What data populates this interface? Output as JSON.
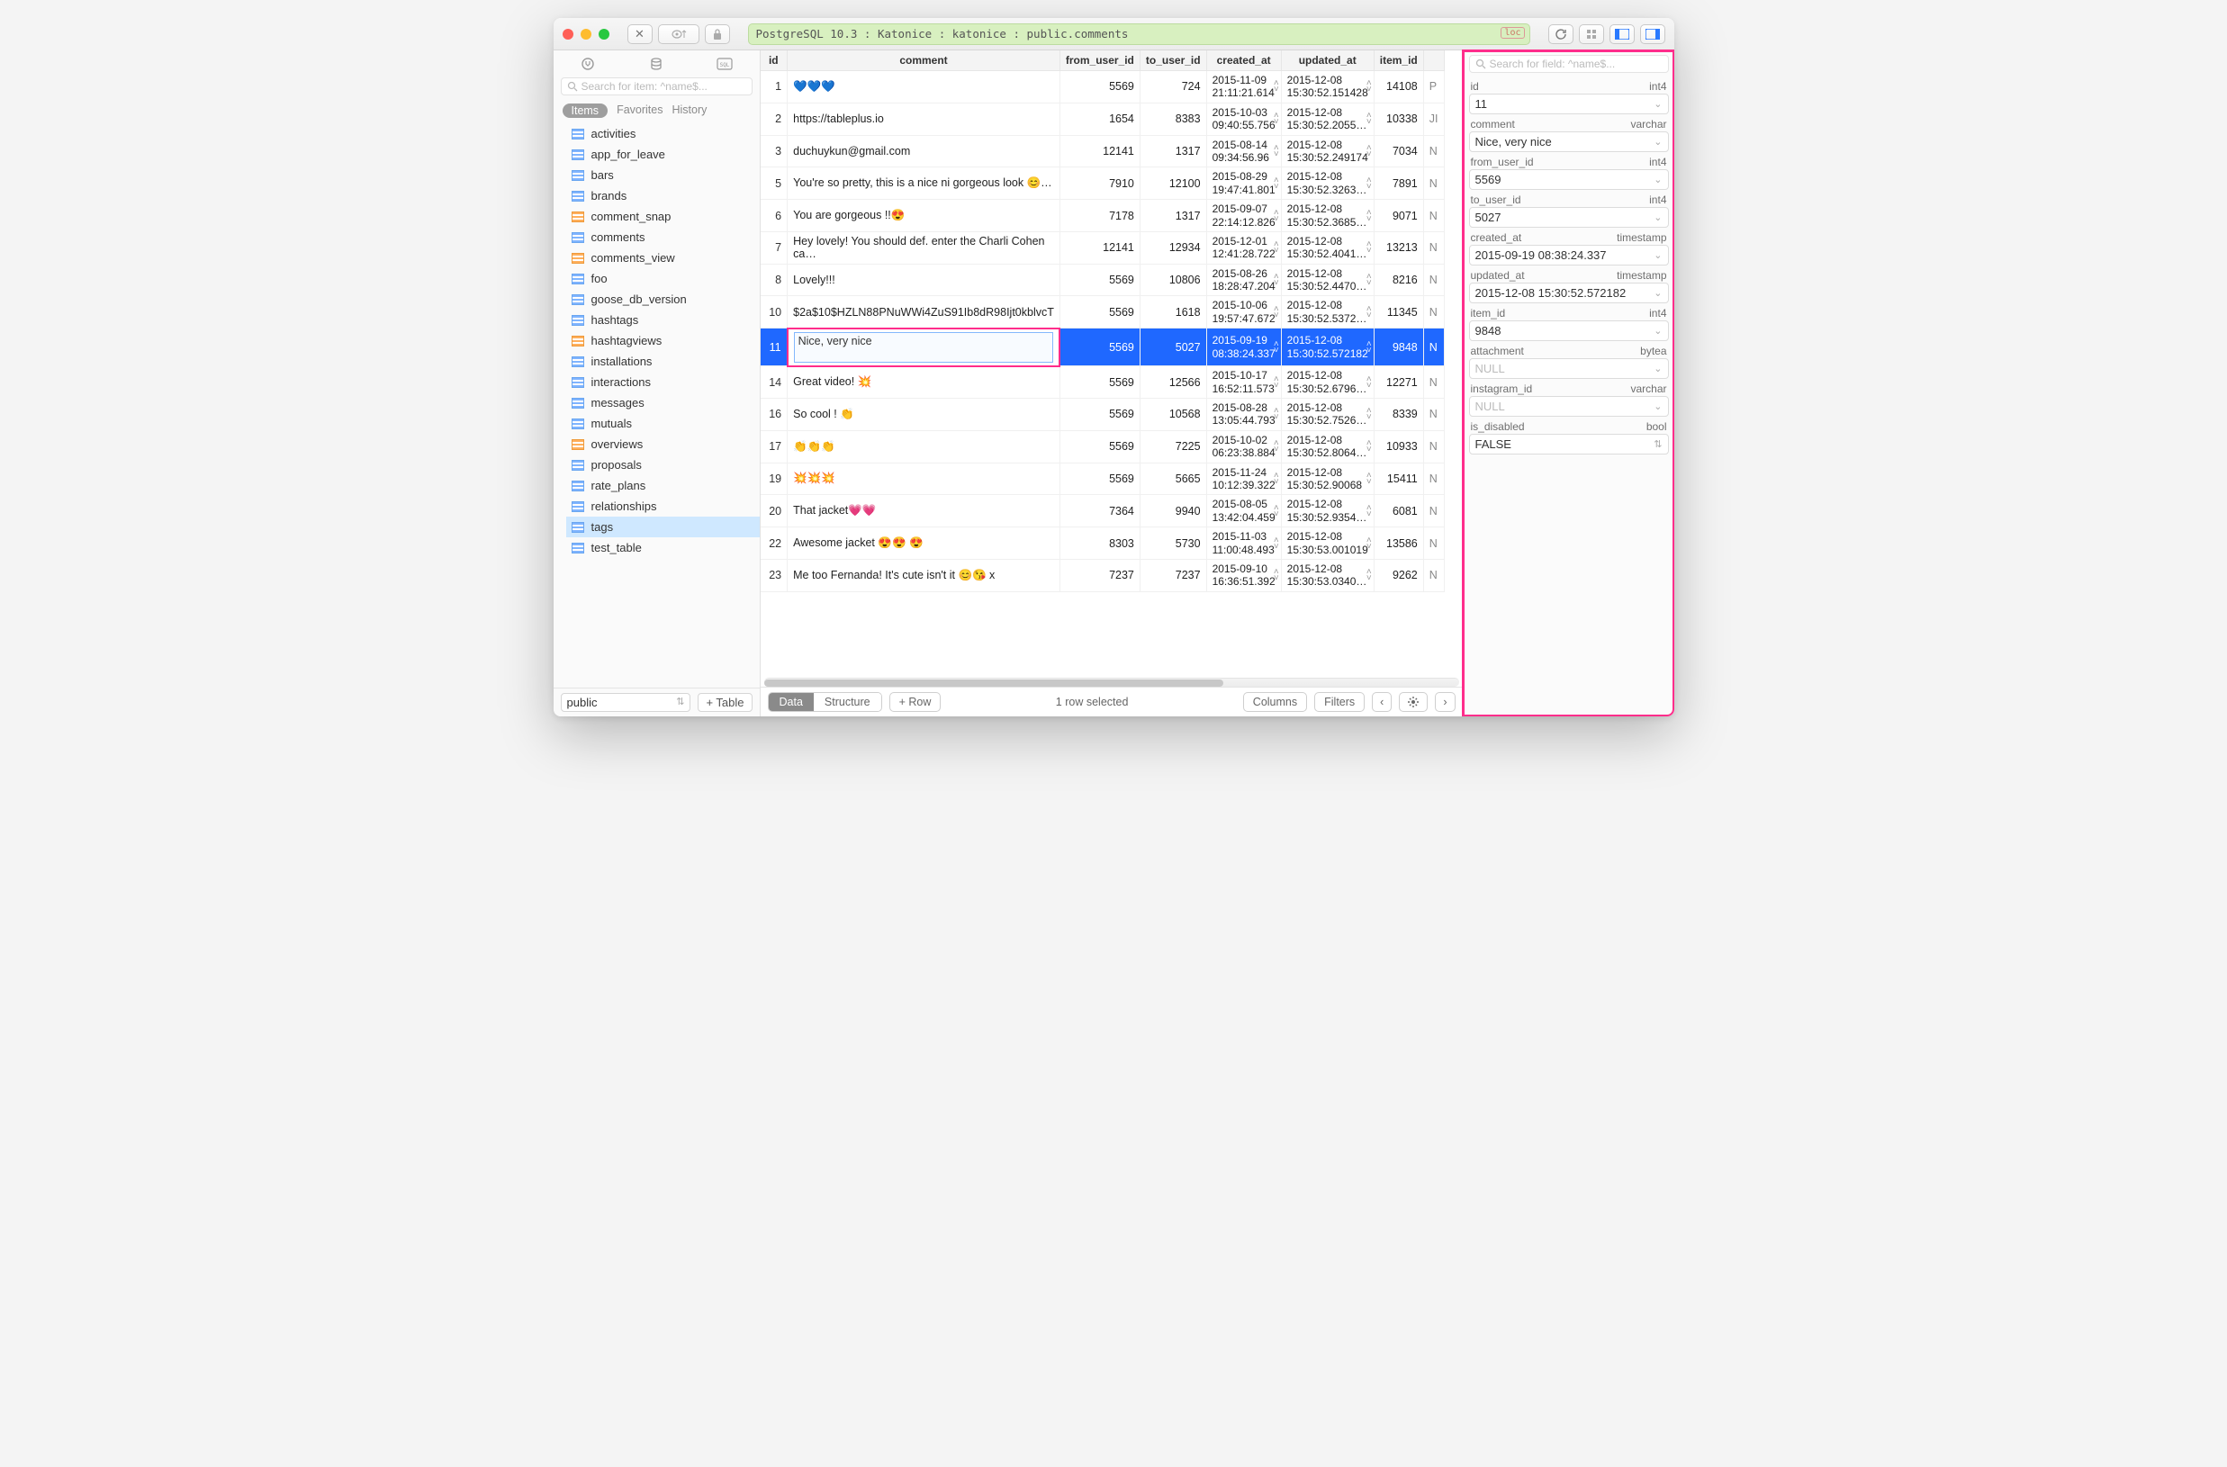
{
  "titlebar": {
    "breadcrumb": "PostgreSQL 10.3 : Katonice : katonice : public.comments",
    "loc_badge": "loc"
  },
  "sidebar": {
    "search_placeholder": "Search for item: ^name$...",
    "tabs": {
      "items": "Items",
      "favorites": "Favorites",
      "history": "History"
    },
    "tables": [
      {
        "name": "activities",
        "kind": "table"
      },
      {
        "name": "app_for_leave",
        "kind": "table"
      },
      {
        "name": "bars",
        "kind": "table"
      },
      {
        "name": "brands",
        "kind": "table"
      },
      {
        "name": "comment_snap",
        "kind": "view"
      },
      {
        "name": "comments",
        "kind": "table"
      },
      {
        "name": "comments_view",
        "kind": "view"
      },
      {
        "name": "foo",
        "kind": "table"
      },
      {
        "name": "goose_db_version",
        "kind": "table"
      },
      {
        "name": "hashtags",
        "kind": "table"
      },
      {
        "name": "hashtagviews",
        "kind": "view"
      },
      {
        "name": "installations",
        "kind": "table"
      },
      {
        "name": "interactions",
        "kind": "table"
      },
      {
        "name": "messages",
        "kind": "table"
      },
      {
        "name": "mutuals",
        "kind": "table"
      },
      {
        "name": "overviews",
        "kind": "view"
      },
      {
        "name": "proposals",
        "kind": "table"
      },
      {
        "name": "rate_plans",
        "kind": "table"
      },
      {
        "name": "relationships",
        "kind": "table"
      },
      {
        "name": "tags",
        "kind": "table",
        "selected": true
      },
      {
        "name": "test_table",
        "kind": "table"
      }
    ],
    "schema_selector": "public",
    "add_table_btn": "+  Table"
  },
  "table": {
    "columns": [
      "id",
      "comment",
      "from_user_id",
      "to_user_id",
      "created_at",
      "updated_at",
      "item_id",
      ""
    ],
    "rows": [
      {
        "id": "1",
        "comment": "💙💙💙",
        "from": "5569",
        "to": "724",
        "created": "2015-11-09 21:11:21.614",
        "updated": "2015-12-08 15:30:52.151428",
        "item": "14108",
        "trail": "P"
      },
      {
        "id": "2",
        "comment": "https://tableplus.io",
        "from": "1654",
        "to": "8383",
        "created": "2015-10-03 09:40:55.756",
        "updated": "2015-12-08 15:30:52.2055…",
        "item": "10338",
        "trail": "JI"
      },
      {
        "id": "3",
        "comment": "duchuykun@gmail.com",
        "from": "12141",
        "to": "1317",
        "created": "2015-08-14 09:34:56.96",
        "updated": "2015-12-08 15:30:52.249174",
        "item": "7034",
        "trail": "N"
      },
      {
        "id": "5",
        "comment": "You're so pretty, this is a nice ni gorgeous look 😊…",
        "from": "7910",
        "to": "12100",
        "created": "2015-08-29 19:47:41.801",
        "updated": "2015-12-08 15:30:52.3263…",
        "item": "7891",
        "trail": "N"
      },
      {
        "id": "6",
        "comment": "You are gorgeous !!😍",
        "from": "7178",
        "to": "1317",
        "created": "2015-09-07 22:14:12.826",
        "updated": "2015-12-08 15:30:52.3685…",
        "item": "9071",
        "trail": "N"
      },
      {
        "id": "7",
        "comment": "Hey lovely! You should def. enter the Charli Cohen ca…",
        "from": "12141",
        "to": "12934",
        "created": "2015-12-01 12:41:28.722",
        "updated": "2015-12-08 15:30:52.4041…",
        "item": "13213",
        "trail": "N"
      },
      {
        "id": "8",
        "comment": "Lovely!!!",
        "from": "5569",
        "to": "10806",
        "created": "2015-08-26 18:28:47.204",
        "updated": "2015-12-08 15:30:52.4470…",
        "item": "8216",
        "trail": "N"
      },
      {
        "id": "10",
        "comment": "$2a$10$HZLN88PNuWWi4ZuS91Ib8dR98Ijt0kblvcT",
        "from": "5569",
        "to": "1618",
        "created": "2015-10-06 19:57:47.672",
        "updated": "2015-12-08 15:30:52.5372…",
        "item": "11345",
        "trail": "N"
      },
      {
        "id": "11",
        "comment": "Nice, very nice",
        "from": "5569",
        "to": "5027",
        "created": "2015-09-19 08:38:24.337",
        "updated": "2015-12-08 15:30:52.572182",
        "item": "9848",
        "trail": "N",
        "selected": true,
        "editing": true
      },
      {
        "id": "14",
        "comment": "Great video! 💥",
        "from": "5569",
        "to": "12566",
        "created": "2015-10-17 16:52:11.573",
        "updated": "2015-12-08 15:30:52.6796…",
        "item": "12271",
        "trail": "N"
      },
      {
        "id": "16",
        "comment": "So cool ! 👏",
        "from": "5569",
        "to": "10568",
        "created": "2015-08-28 13:05:44.793",
        "updated": "2015-12-08 15:30:52.7526…",
        "item": "8339",
        "trail": "N"
      },
      {
        "id": "17",
        "comment": "👏👏👏",
        "from": "5569",
        "to": "7225",
        "created": "2015-10-02 06:23:38.884",
        "updated": "2015-12-08 15:30:52.8064…",
        "item": "10933",
        "trail": "N"
      },
      {
        "id": "19",
        "comment": "💥💥💥",
        "from": "5569",
        "to": "5665",
        "created": "2015-11-24 10:12:39.322",
        "updated": "2015-12-08 15:30:52.90068",
        "item": "15411",
        "trail": "N"
      },
      {
        "id": "20",
        "comment": "That jacket💗💗",
        "from": "7364",
        "to": "9940",
        "created": "2015-08-05 13:42:04.459",
        "updated": "2015-12-08 15:30:52.9354…",
        "item": "6081",
        "trail": "N"
      },
      {
        "id": "22",
        "comment": "Awesome jacket 😍😍 😍",
        "from": "8303",
        "to": "5730",
        "created": "2015-11-03 11:00:48.493",
        "updated": "2015-12-08 15:30:53.001019",
        "item": "13586",
        "trail": "N"
      },
      {
        "id": "23",
        "comment": "Me too Fernanda! It's cute isn't it 😊😘 x",
        "from": "7237",
        "to": "7237",
        "created": "2015-09-10 16:36:51.392",
        "updated": "2015-12-08 15:30:53.0340…",
        "item": "9262",
        "trail": "N"
      }
    ]
  },
  "center_footer": {
    "data": "Data",
    "structure": "Structure",
    "addrow": "+   Row",
    "status": "1 row selected",
    "columns_btn": "Columns",
    "filters_btn": "Filters"
  },
  "rightpanel": {
    "search_placeholder": "Search for field: ^name$...",
    "fields": [
      {
        "name": "id",
        "type": "int4",
        "value": "11"
      },
      {
        "name": "comment",
        "type": "varchar",
        "value": "Nice, very nice"
      },
      {
        "name": "from_user_id",
        "type": "int4",
        "value": "5569"
      },
      {
        "name": "to_user_id",
        "type": "int4",
        "value": "5027"
      },
      {
        "name": "created_at",
        "type": "timestamp",
        "value": "2015-09-19 08:38:24.337"
      },
      {
        "name": "updated_at",
        "type": "timestamp",
        "value": "2015-12-08 15:30:52.572182"
      },
      {
        "name": "item_id",
        "type": "int4",
        "value": "9848"
      },
      {
        "name": "attachment",
        "type": "bytea",
        "value": "NULL",
        "null": true
      },
      {
        "name": "instagram_id",
        "type": "varchar",
        "value": "NULL",
        "null": true
      },
      {
        "name": "is_disabled",
        "type": "bool",
        "value": "FALSE",
        "stepper": true
      }
    ]
  }
}
